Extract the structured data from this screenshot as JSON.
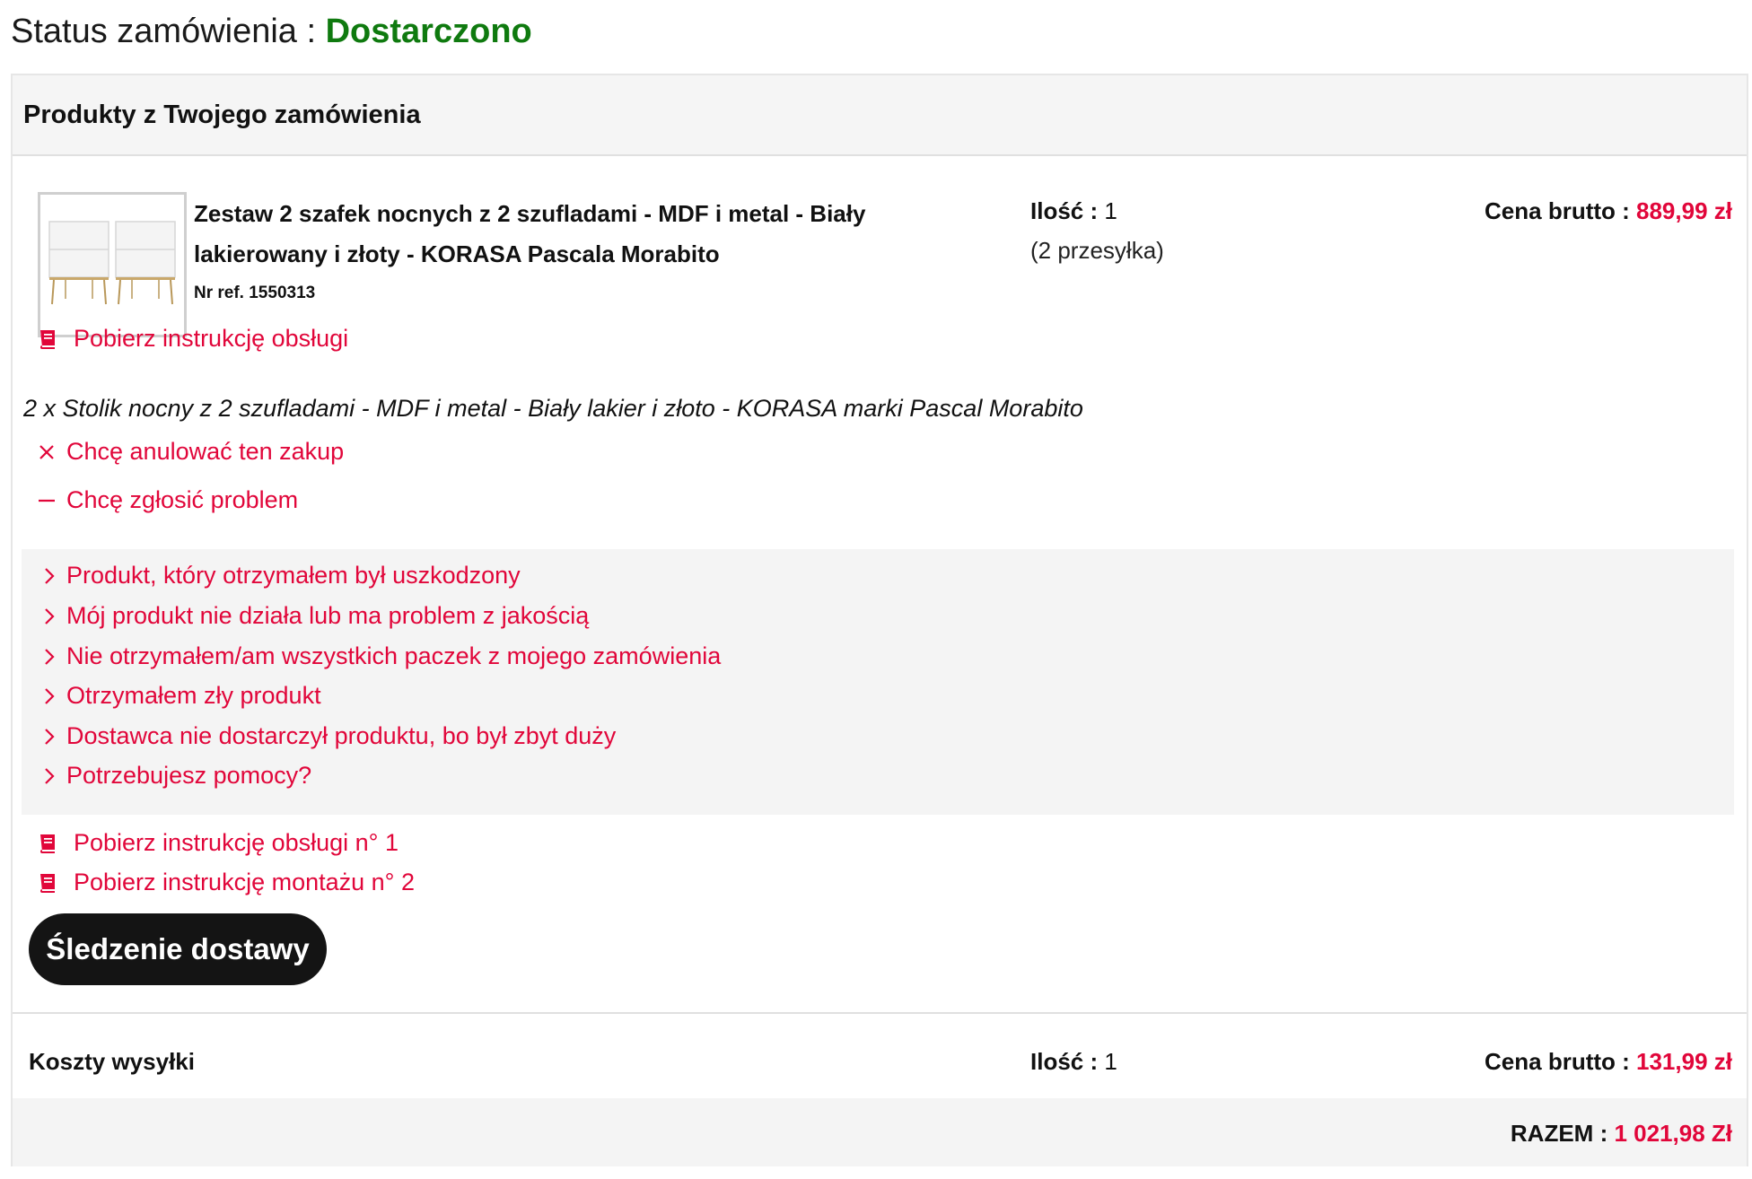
{
  "status": {
    "label": "Status zamówienia : ",
    "value": "Dostarczono"
  },
  "panel": {
    "title": "Produkty z Twojego zamówienia"
  },
  "product": {
    "name": "Zestaw 2 szafek nocnych z 2 szufladami - MDF i metal - Biały lakierowany i złoty - KORASA Pascala Morabito",
    "ref": "Nr ref. 1550313",
    "qty_label": "Ilość : ",
    "qty_value": "1",
    "shipment_note": "(2 przesyłka)",
    "price_label": "Cena brutto : ",
    "price_value": "889,99 zł",
    "manual_link": "Pobierz instrukcję obsługi",
    "set_description": "2 x Stolik nocny z 2 szufladami - MDF i metal - Biały lakier i złoto - KORASA marki Pascal Morabito"
  },
  "actions": {
    "cancel": "Chcę anulować ten zakup",
    "report": "Chcę zgłosić problem"
  },
  "problems": [
    "Produkt, który otrzymałem był uszkodzony",
    "Mój produkt nie działa lub ma problem z jakością",
    "Nie otrzymałem/am wszystkich paczek z mojego zamówienia",
    "Otrzymałem zły produkt",
    "Dostawca nie dostarczył produktu, bo był zbyt duży",
    "Potrzebujesz pomocy?"
  ],
  "downloads": [
    "Pobierz instrukcję obsługi n° 1",
    "Pobierz instrukcję montażu n° 2"
  ],
  "tracking_button": "Śledzenie dostawy",
  "shipping": {
    "label": "Koszty wysyłki",
    "qty_label": "Ilość : ",
    "qty_value": "1",
    "price_label": "Cena brutto : ",
    "price_value": "131,99 zł"
  },
  "total": {
    "label": "RAZEM : ",
    "value": "1 021,98 Zł"
  },
  "colors": {
    "accent": "#e1063a",
    "status": "#0f7a0f",
    "button": "#141414"
  },
  "icons": [
    "book-icon",
    "close-icon",
    "minus-icon",
    "chevron-right-icon"
  ]
}
